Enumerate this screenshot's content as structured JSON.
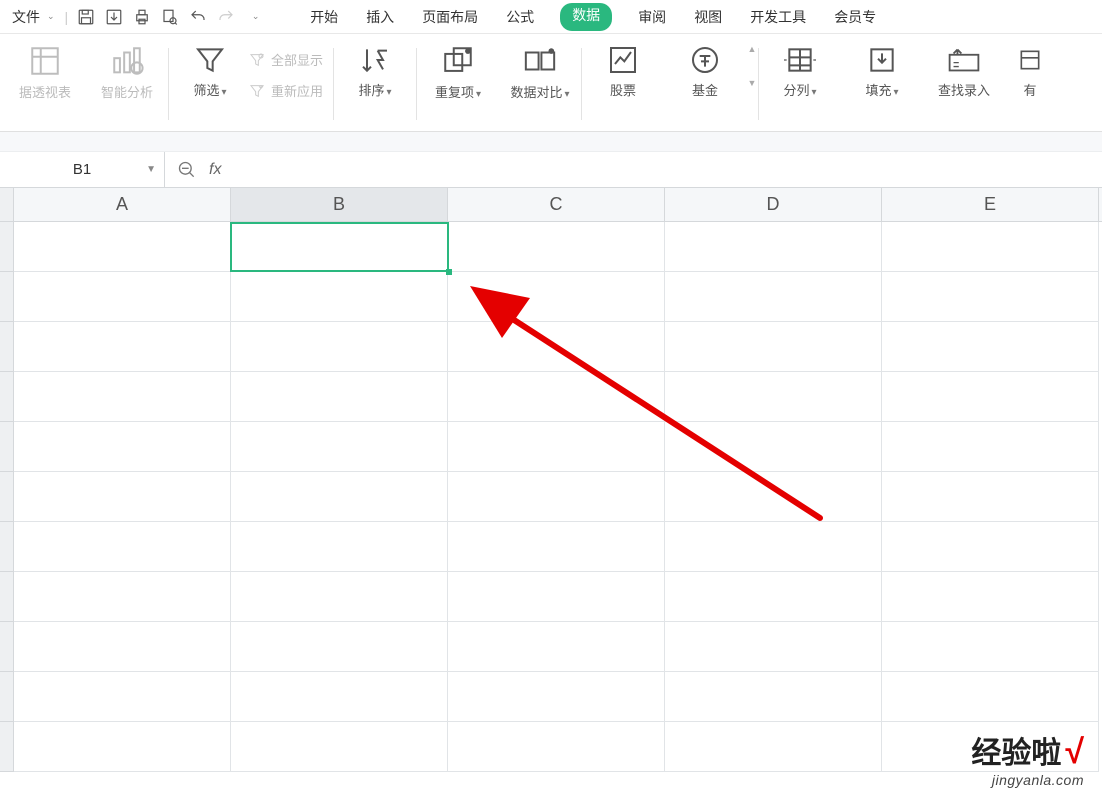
{
  "menubar": {
    "file_label": "文件",
    "tabs": [
      "开始",
      "插入",
      "页面布局",
      "公式",
      "数据",
      "审阅",
      "视图",
      "开发工具",
      "会员专"
    ],
    "active_tab_index": 4
  },
  "ribbon": {
    "pivot_label": "据透视表",
    "smart_label": "智能分析",
    "filter_label": "筛选",
    "show_all_label": "全部显示",
    "reapply_label": "重新应用",
    "sort_label": "排序",
    "duplicates_label": "重复项",
    "compare_label": "数据对比",
    "stock_label": "股票",
    "fund_label": "基金",
    "split_label": "分列",
    "fill_label": "填充",
    "find_input_label": "查找录入",
    "youxiao_label": "有"
  },
  "formula_bar": {
    "name_box": "B1",
    "fx_label": "fx",
    "formula_value": ""
  },
  "grid": {
    "columns": [
      "A",
      "B",
      "C",
      "D",
      "E"
    ],
    "selected_column_index": 1,
    "first_row_height": 50,
    "row_count": 11,
    "selected_cell": "B1"
  },
  "watermark": {
    "title": "经验啦",
    "check": "√",
    "url": "jingyanla.com"
  },
  "colors": {
    "accent": "#2ab87f",
    "arrow": "#e40000"
  }
}
